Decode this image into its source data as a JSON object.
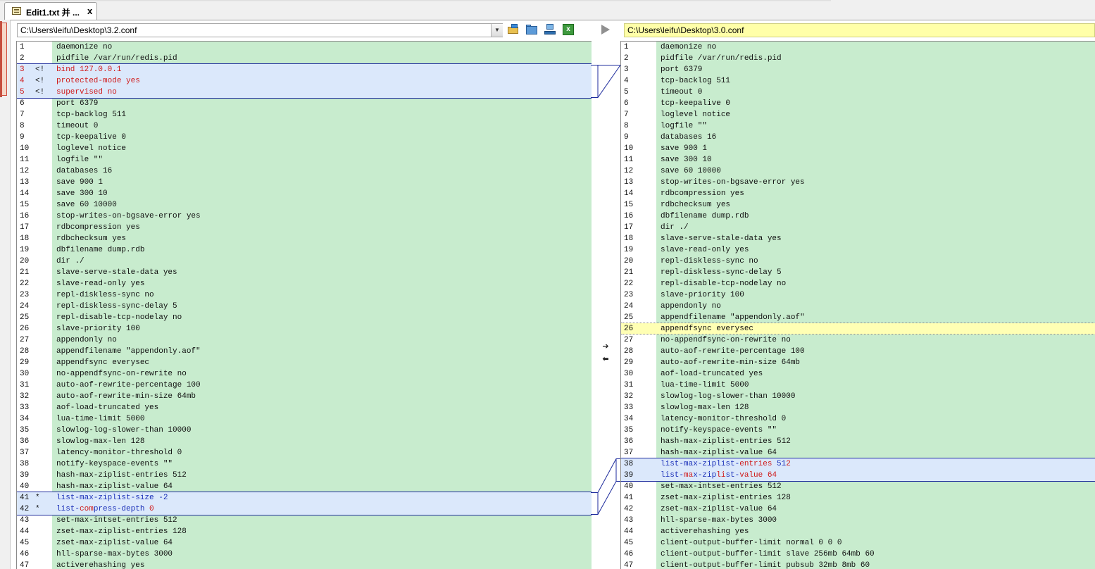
{
  "tab": {
    "label": "Edit1.txt 并 ...",
    "close_label": "x"
  },
  "left": {
    "path": "C:\\Users\\leifu\\Desktop\\3.2.conf",
    "lines": [
      {
        "n": "1",
        "m": "",
        "t": "daemonize no"
      },
      {
        "n": "2",
        "m": "",
        "t": "pidfile /var/run/redis.pid"
      },
      {
        "n": "3",
        "m": "<!",
        "t": "bind 127.0.0.1",
        "diff": "red"
      },
      {
        "n": "4",
        "m": "<!",
        "t": "protected-mode yes",
        "diff": "red"
      },
      {
        "n": "5",
        "m": "<!",
        "t": "supervised no",
        "diff": "red"
      },
      {
        "n": "6",
        "m": "",
        "t": "port 6379"
      },
      {
        "n": "7",
        "m": "",
        "t": "tcp-backlog 511"
      },
      {
        "n": "8",
        "m": "",
        "t": "timeout 0"
      },
      {
        "n": "9",
        "m": "",
        "t": "tcp-keepalive 0"
      },
      {
        "n": "10",
        "m": "",
        "t": "loglevel notice"
      },
      {
        "n": "11",
        "m": "",
        "t": "logfile \"\""
      },
      {
        "n": "12",
        "m": "",
        "t": "databases 16"
      },
      {
        "n": "13",
        "m": "",
        "t": "save 900 1"
      },
      {
        "n": "14",
        "m": "",
        "t": "save 300 10"
      },
      {
        "n": "15",
        "m": "",
        "t": "save 60 10000"
      },
      {
        "n": "16",
        "m": "",
        "t": "stop-writes-on-bgsave-error yes"
      },
      {
        "n": "17",
        "m": "",
        "t": "rdbcompression yes"
      },
      {
        "n": "18",
        "m": "",
        "t": "rdbchecksum yes"
      },
      {
        "n": "19",
        "m": "",
        "t": "dbfilename dump.rdb"
      },
      {
        "n": "20",
        "m": "",
        "t": "dir ./"
      },
      {
        "n": "21",
        "m": "",
        "t": "slave-serve-stale-data yes"
      },
      {
        "n": "22",
        "m": "",
        "t": "slave-read-only yes"
      },
      {
        "n": "23",
        "m": "",
        "t": "repl-diskless-sync no"
      },
      {
        "n": "24",
        "m": "",
        "t": "repl-diskless-sync-delay 5"
      },
      {
        "n": "25",
        "m": "",
        "t": "repl-disable-tcp-nodelay no"
      },
      {
        "n": "26",
        "m": "",
        "t": "slave-priority 100"
      },
      {
        "n": "27",
        "m": "",
        "t": "appendonly no"
      },
      {
        "n": "28",
        "m": "",
        "t": "appendfilename \"appendonly.aof\""
      },
      {
        "n": "29",
        "m": "",
        "t": "appendfsync everysec"
      },
      {
        "n": "30",
        "m": "",
        "t": "no-appendfsync-on-rewrite no"
      },
      {
        "n": "31",
        "m": "",
        "t": "auto-aof-rewrite-percentage 100"
      },
      {
        "n": "32",
        "m": "",
        "t": "auto-aof-rewrite-min-size 64mb"
      },
      {
        "n": "33",
        "m": "",
        "t": "aof-load-truncated yes"
      },
      {
        "n": "34",
        "m": "",
        "t": "lua-time-limit 5000"
      },
      {
        "n": "35",
        "m": "",
        "t": "slowlog-log-slower-than 10000"
      },
      {
        "n": "36",
        "m": "",
        "t": "slowlog-max-len 128"
      },
      {
        "n": "37",
        "m": "",
        "t": "latency-monitor-threshold 0"
      },
      {
        "n": "38",
        "m": "",
        "t": "notify-keyspace-events \"\""
      },
      {
        "n": "39",
        "m": "",
        "t": "hash-max-ziplist-entries 512"
      },
      {
        "n": "40",
        "m": "",
        "t": "hash-max-ziplist-value 64"
      },
      {
        "n": "41",
        "m": "*",
        "t": "list-max-ziplist-size -2",
        "diff": "mixed1"
      },
      {
        "n": "42",
        "m": "*",
        "t": "list-compress-depth 0",
        "diff": "mixed2"
      },
      {
        "n": "43",
        "m": "",
        "t": "set-max-intset-entries 512"
      },
      {
        "n": "44",
        "m": "",
        "t": "zset-max-ziplist-entries 128"
      },
      {
        "n": "45",
        "m": "",
        "t": "zset-max-ziplist-value 64"
      },
      {
        "n": "46",
        "m": "",
        "t": "hll-sparse-max-bytes 3000"
      },
      {
        "n": "47",
        "m": "",
        "t": "activerehashing yes"
      }
    ]
  },
  "right": {
    "path": "C:\\Users\\leifu\\Desktop\\3.0.conf",
    "lines": [
      {
        "n": "1",
        "m": "",
        "t": "daemonize no"
      },
      {
        "n": "2",
        "m": "",
        "t": "pidfile /var/run/redis.pid"
      },
      {
        "n": "3",
        "m": "",
        "t": "port 6379"
      },
      {
        "n": "4",
        "m": "",
        "t": "tcp-backlog 511"
      },
      {
        "n": "5",
        "m": "",
        "t": "timeout 0"
      },
      {
        "n": "6",
        "m": "",
        "t": "tcp-keepalive 0"
      },
      {
        "n": "7",
        "m": "",
        "t": "loglevel notice"
      },
      {
        "n": "8",
        "m": "",
        "t": "logfile \"\""
      },
      {
        "n": "9",
        "m": "",
        "t": "databases 16"
      },
      {
        "n": "10",
        "m": "",
        "t": "save 900 1"
      },
      {
        "n": "11",
        "m": "",
        "t": "save 300 10"
      },
      {
        "n": "12",
        "m": "",
        "t": "save 60 10000"
      },
      {
        "n": "13",
        "m": "",
        "t": "stop-writes-on-bgsave-error yes"
      },
      {
        "n": "14",
        "m": "",
        "t": "rdbcompression yes"
      },
      {
        "n": "15",
        "m": "",
        "t": "rdbchecksum yes"
      },
      {
        "n": "16",
        "m": "",
        "t": "dbfilename dump.rdb"
      },
      {
        "n": "17",
        "m": "",
        "t": "dir ./"
      },
      {
        "n": "18",
        "m": "",
        "t": "slave-serve-stale-data yes"
      },
      {
        "n": "19",
        "m": "",
        "t": "slave-read-only yes"
      },
      {
        "n": "20",
        "m": "",
        "t": "repl-diskless-sync no"
      },
      {
        "n": "21",
        "m": "",
        "t": "repl-diskless-sync-delay 5"
      },
      {
        "n": "22",
        "m": "",
        "t": "repl-disable-tcp-nodelay no"
      },
      {
        "n": "23",
        "m": "",
        "t": "slave-priority 100"
      },
      {
        "n": "24",
        "m": "",
        "t": "appendonly no"
      },
      {
        "n": "25",
        "m": "",
        "t": "appendfilename \"appendonly.aof\""
      },
      {
        "n": "26",
        "m": "",
        "t": "appendfsync everysec",
        "diff": "yellow"
      },
      {
        "n": "27",
        "m": "",
        "t": "no-appendfsync-on-rewrite no"
      },
      {
        "n": "28",
        "m": "",
        "t": "auto-aof-rewrite-percentage 100"
      },
      {
        "n": "29",
        "m": "",
        "t": "auto-aof-rewrite-min-size 64mb"
      },
      {
        "n": "30",
        "m": "",
        "t": "aof-load-truncated yes"
      },
      {
        "n": "31",
        "m": "",
        "t": "lua-time-limit 5000"
      },
      {
        "n": "32",
        "m": "",
        "t": "slowlog-log-slower-than 10000"
      },
      {
        "n": "33",
        "m": "",
        "t": "slowlog-max-len 128"
      },
      {
        "n": "34",
        "m": "",
        "t": "latency-monitor-threshold 0"
      },
      {
        "n": "35",
        "m": "",
        "t": "notify-keyspace-events \"\""
      },
      {
        "n": "36",
        "m": "",
        "t": "hash-max-ziplist-entries 512"
      },
      {
        "n": "37",
        "m": "",
        "t": "hash-max-ziplist-value 64"
      },
      {
        "n": "38",
        "m": "",
        "t": "list-max-ziplist-entries 512",
        "diff": "mixed3"
      },
      {
        "n": "39",
        "m": "",
        "t": "list-max-ziplist-value 64",
        "diff": "mixed4"
      },
      {
        "n": "40",
        "m": "",
        "t": "set-max-intset-entries 512"
      },
      {
        "n": "41",
        "m": "",
        "t": "zset-max-ziplist-entries 128"
      },
      {
        "n": "42",
        "m": "",
        "t": "zset-max-ziplist-value 64"
      },
      {
        "n": "43",
        "m": "",
        "t": "hll-sparse-max-bytes 3000"
      },
      {
        "n": "44",
        "m": "",
        "t": "activerehashing yes"
      },
      {
        "n": "45",
        "m": "",
        "t": "client-output-buffer-limit normal 0 0 0"
      },
      {
        "n": "46",
        "m": "",
        "t": "client-output-buffer-limit slave 256mb 64mb 60"
      },
      {
        "n": "47",
        "m": "",
        "t": "client-output-buffer-limit pubsub 32mb 8mb 60"
      }
    ]
  },
  "icons": {
    "open": "open-file-icon",
    "folder": "folder-icon",
    "network": "network-icon",
    "excel": "excel-icon",
    "play": "play-icon",
    "copy_right": "copy-to-right-icon",
    "copy_left": "copy-to-left-icon"
  },
  "colors": {
    "match_bg": "#c8ecce",
    "diff_bg": "#dbe8fb",
    "changed_bg": "#ffffb4",
    "diff_border": "#1c2a9c",
    "removed_text": "#d01a1a",
    "changed_text": "#1a2fb8"
  },
  "middle": {
    "copy_right_glyph": "➔",
    "copy_left_glyph": "⬅"
  }
}
